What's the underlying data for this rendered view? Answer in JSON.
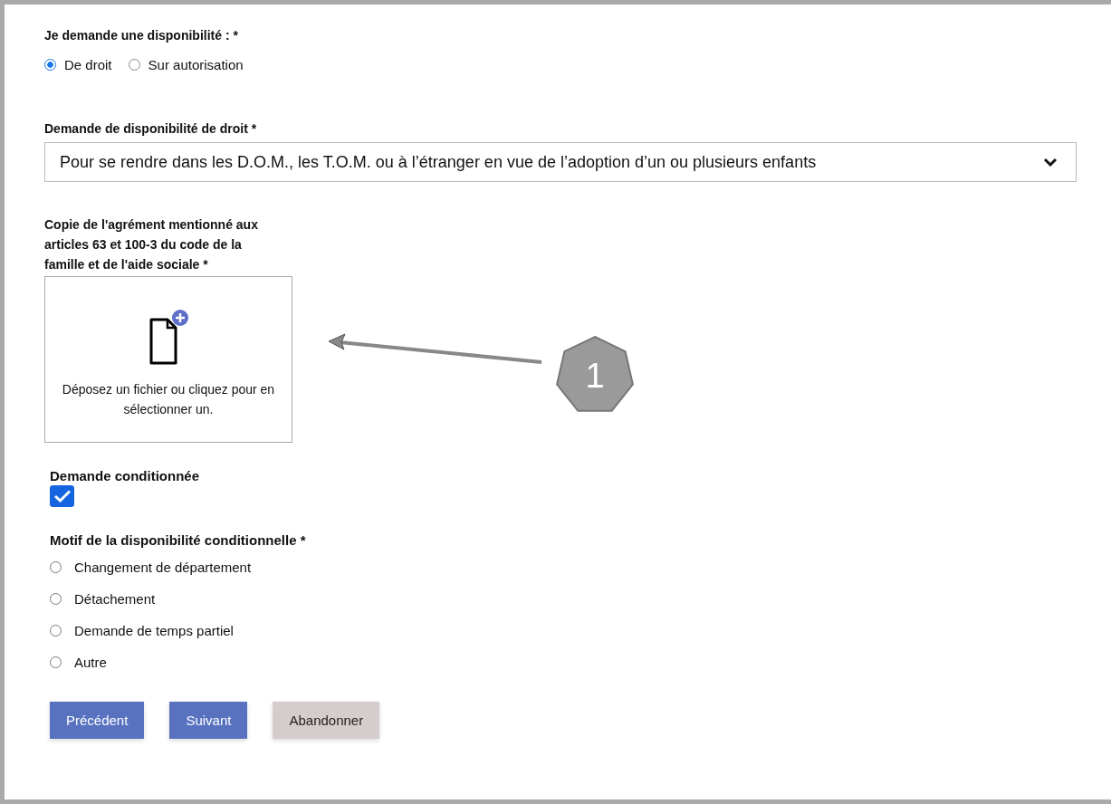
{
  "request_type": {
    "label": "Je demande une disponibilité : *",
    "options": [
      {
        "label": "De droit",
        "selected": true
      },
      {
        "label": "Sur autorisation",
        "selected": false
      }
    ]
  },
  "right_request": {
    "label": "Demande de disponibilité de droit *",
    "value": "Pour se rendre dans les D.O.M., les T.O.M. ou à l’étranger en vue de l’adoption d’un ou plusieurs enfants"
  },
  "upload": {
    "label": "Copie de l'agrément mentionné aux articles 63 et 100-3 du code de la famille et de l'aide sociale *",
    "hint": "Déposez un fichier ou cliquez pour en sélectionner un."
  },
  "conditional": {
    "label": "Demande conditionnée",
    "checked": true
  },
  "reason": {
    "label": "Motif de la disponibilité conditionnelle *",
    "options": [
      {
        "label": "Changement de département",
        "selected": false
      },
      {
        "label": "Détachement",
        "selected": false
      },
      {
        "label": "Demande de temps partiel",
        "selected": false
      },
      {
        "label": "Autre",
        "selected": false
      }
    ]
  },
  "buttons": [
    {
      "label": "Précédent",
      "kind": "primary"
    },
    {
      "label": "Suivant",
      "kind": "primary"
    },
    {
      "label": "Abandonner",
      "kind": "secondary"
    }
  ],
  "callout": {
    "number": "1"
  }
}
